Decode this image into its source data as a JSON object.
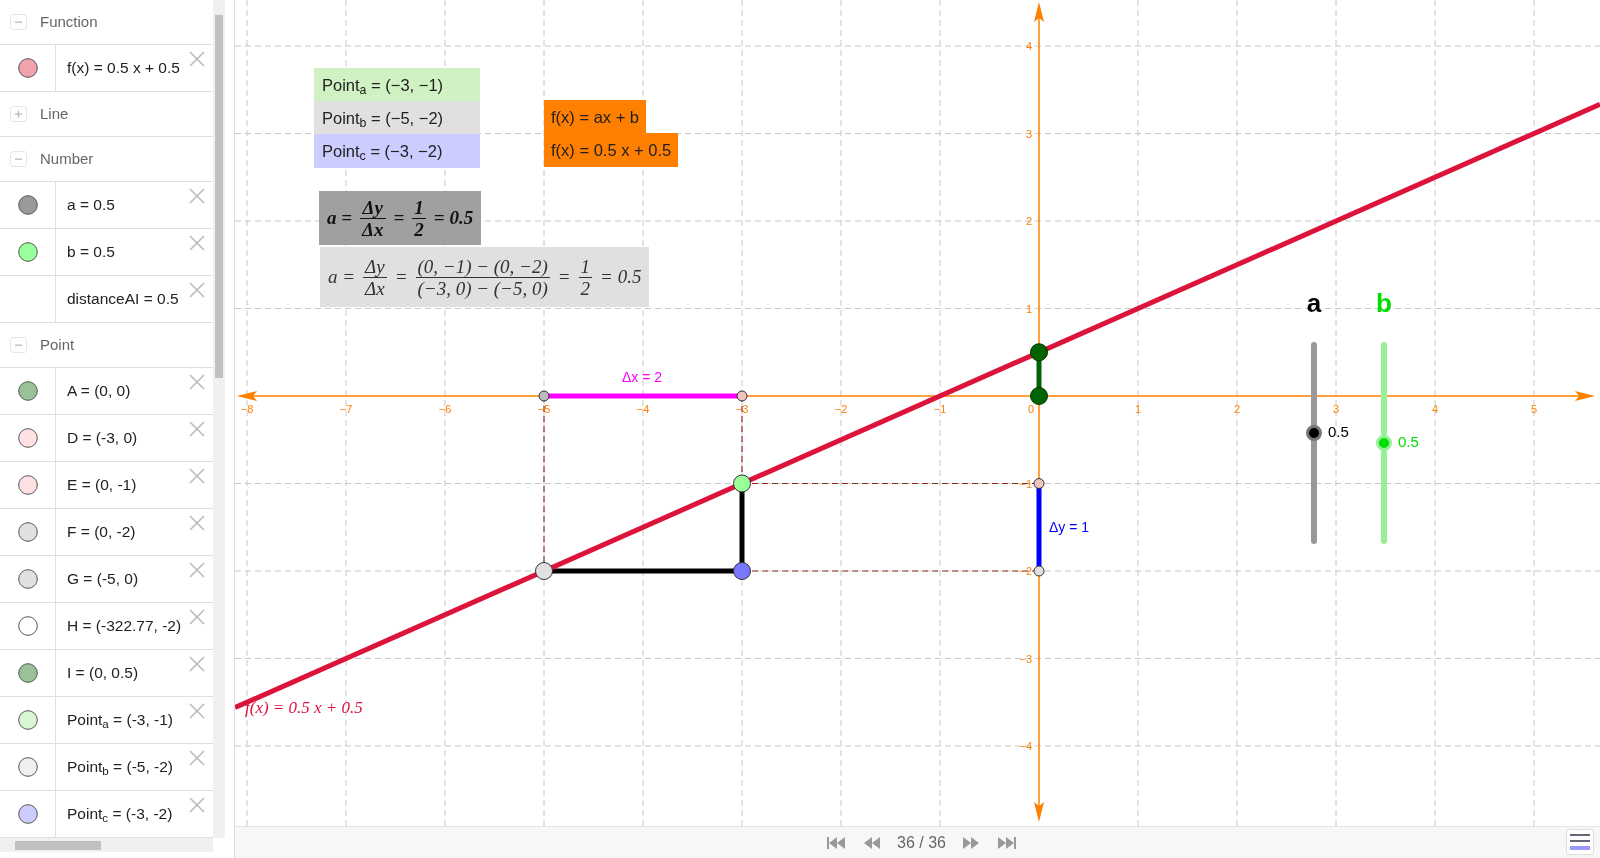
{
  "algebra_view": {
    "items": [
      {
        "kind": "group",
        "label": "Function",
        "expanded": true
      },
      {
        "kind": "object",
        "text": "f(x) = 0.5 x + 0.5",
        "color": "#f0a3ad"
      },
      {
        "kind": "group",
        "label": "Line",
        "expanded": false
      },
      {
        "kind": "group",
        "label": "Number",
        "expanded": true
      },
      {
        "kind": "object",
        "text": "a = 0.5",
        "color": "#999999"
      },
      {
        "kind": "object",
        "text": "b = 0.5",
        "color": "#99ff99"
      },
      {
        "kind": "object",
        "text": "distanceAI = 0.5"
      },
      {
        "kind": "group",
        "label": "Point",
        "expanded": true
      },
      {
        "kind": "object",
        "text": "A = (0, 0)",
        "color": "#99c299"
      },
      {
        "kind": "object",
        "text": "D = (-3, 0)",
        "color": "#ffe0e3"
      },
      {
        "kind": "object",
        "text": "E = (0, -1)",
        "color": "#ffe0e3"
      },
      {
        "kind": "object",
        "text": "F = (0, -2)",
        "color": "#e0e0e0"
      },
      {
        "kind": "object",
        "text": "G = (-5, 0)",
        "color": "#e0e0e0"
      },
      {
        "kind": "object",
        "text": "H = (-322.77, -2)",
        "color": "#ffffff"
      },
      {
        "kind": "object",
        "text": "I = (0, 0.5)",
        "color": "#99c299"
      },
      {
        "kind": "object",
        "text": "Point$_{a}$ = (-3, -1)",
        "color": "#d9f7d3"
      },
      {
        "kind": "object",
        "text": "Point$_{b}$ = (-5, -2)",
        "color": "#f0f0f0"
      },
      {
        "kind": "object",
        "text": "Point$_{c}$ = (-3, -2)",
        "color": "#ccccff"
      }
    ]
  },
  "graphics": {
    "x_tick_labels": [
      "−8",
      "−7",
      "−6",
      "−5",
      "−4",
      "−3",
      "−2",
      "−1",
      "0",
      "1",
      "2",
      "3",
      "4",
      "5"
    ],
    "y_tick_labels": [
      "4",
      "3",
      "2",
      "1",
      "−1",
      "−2",
      "−3",
      "−4"
    ],
    "point_boxes": [
      {
        "text": "Point$_{a}$ = (−3, −1)",
        "color": "#d0f2c2"
      },
      {
        "text": "Point$_{b}$ = (−5, −2)",
        "color": "#e0e0e0"
      },
      {
        "text": "Point$_{c}$ = (−3, −2)",
        "color": "#ccccff"
      }
    ],
    "function_boxes": [
      "f(x) = ax + b",
      "f(x) = 0.5 x + 0.5"
    ],
    "formulas": [
      {
        "kind": "bold",
        "terms": [
          {
            "kind": "text",
            "text": "a ="
          },
          {
            "kind": "frac",
            "num": "Δy",
            "den": "Δx"
          },
          {
            "kind": "text",
            "text": "="
          },
          {
            "kind": "frac",
            "num": "1",
            "den": "2"
          },
          {
            "kind": "text",
            "text": "= 0.5"
          }
        ]
      },
      {
        "kind": "plain",
        "terms": [
          {
            "kind": "text",
            "text": "a ="
          },
          {
            "kind": "frac",
            "num": "Δy",
            "den": "Δx"
          },
          {
            "kind": "text",
            "text": "="
          },
          {
            "kind": "frac",
            "num": "(0, −1) − (0, −2)",
            "den": "(−3, 0) − (−5, 0)"
          },
          {
            "kind": "text",
            "text": "="
          },
          {
            "kind": "frac",
            "num": "1",
            "den": "2"
          },
          {
            "kind": "text",
            "text": "= 0.5"
          }
        ]
      }
    ],
    "dx_label": "Δx = 2",
    "dy_label": "Δy = 1",
    "function_label": "f(x) = 0.5 x + 0.5",
    "sliders": [
      {
        "name": "a",
        "value": "0.5",
        "level": 0.55,
        "color": "#000000"
      },
      {
        "name": "b",
        "value": "0.5",
        "level": 0.5,
        "color": "#00dd00"
      }
    ]
  },
  "playback": {
    "counter": "36 / 36"
  }
}
